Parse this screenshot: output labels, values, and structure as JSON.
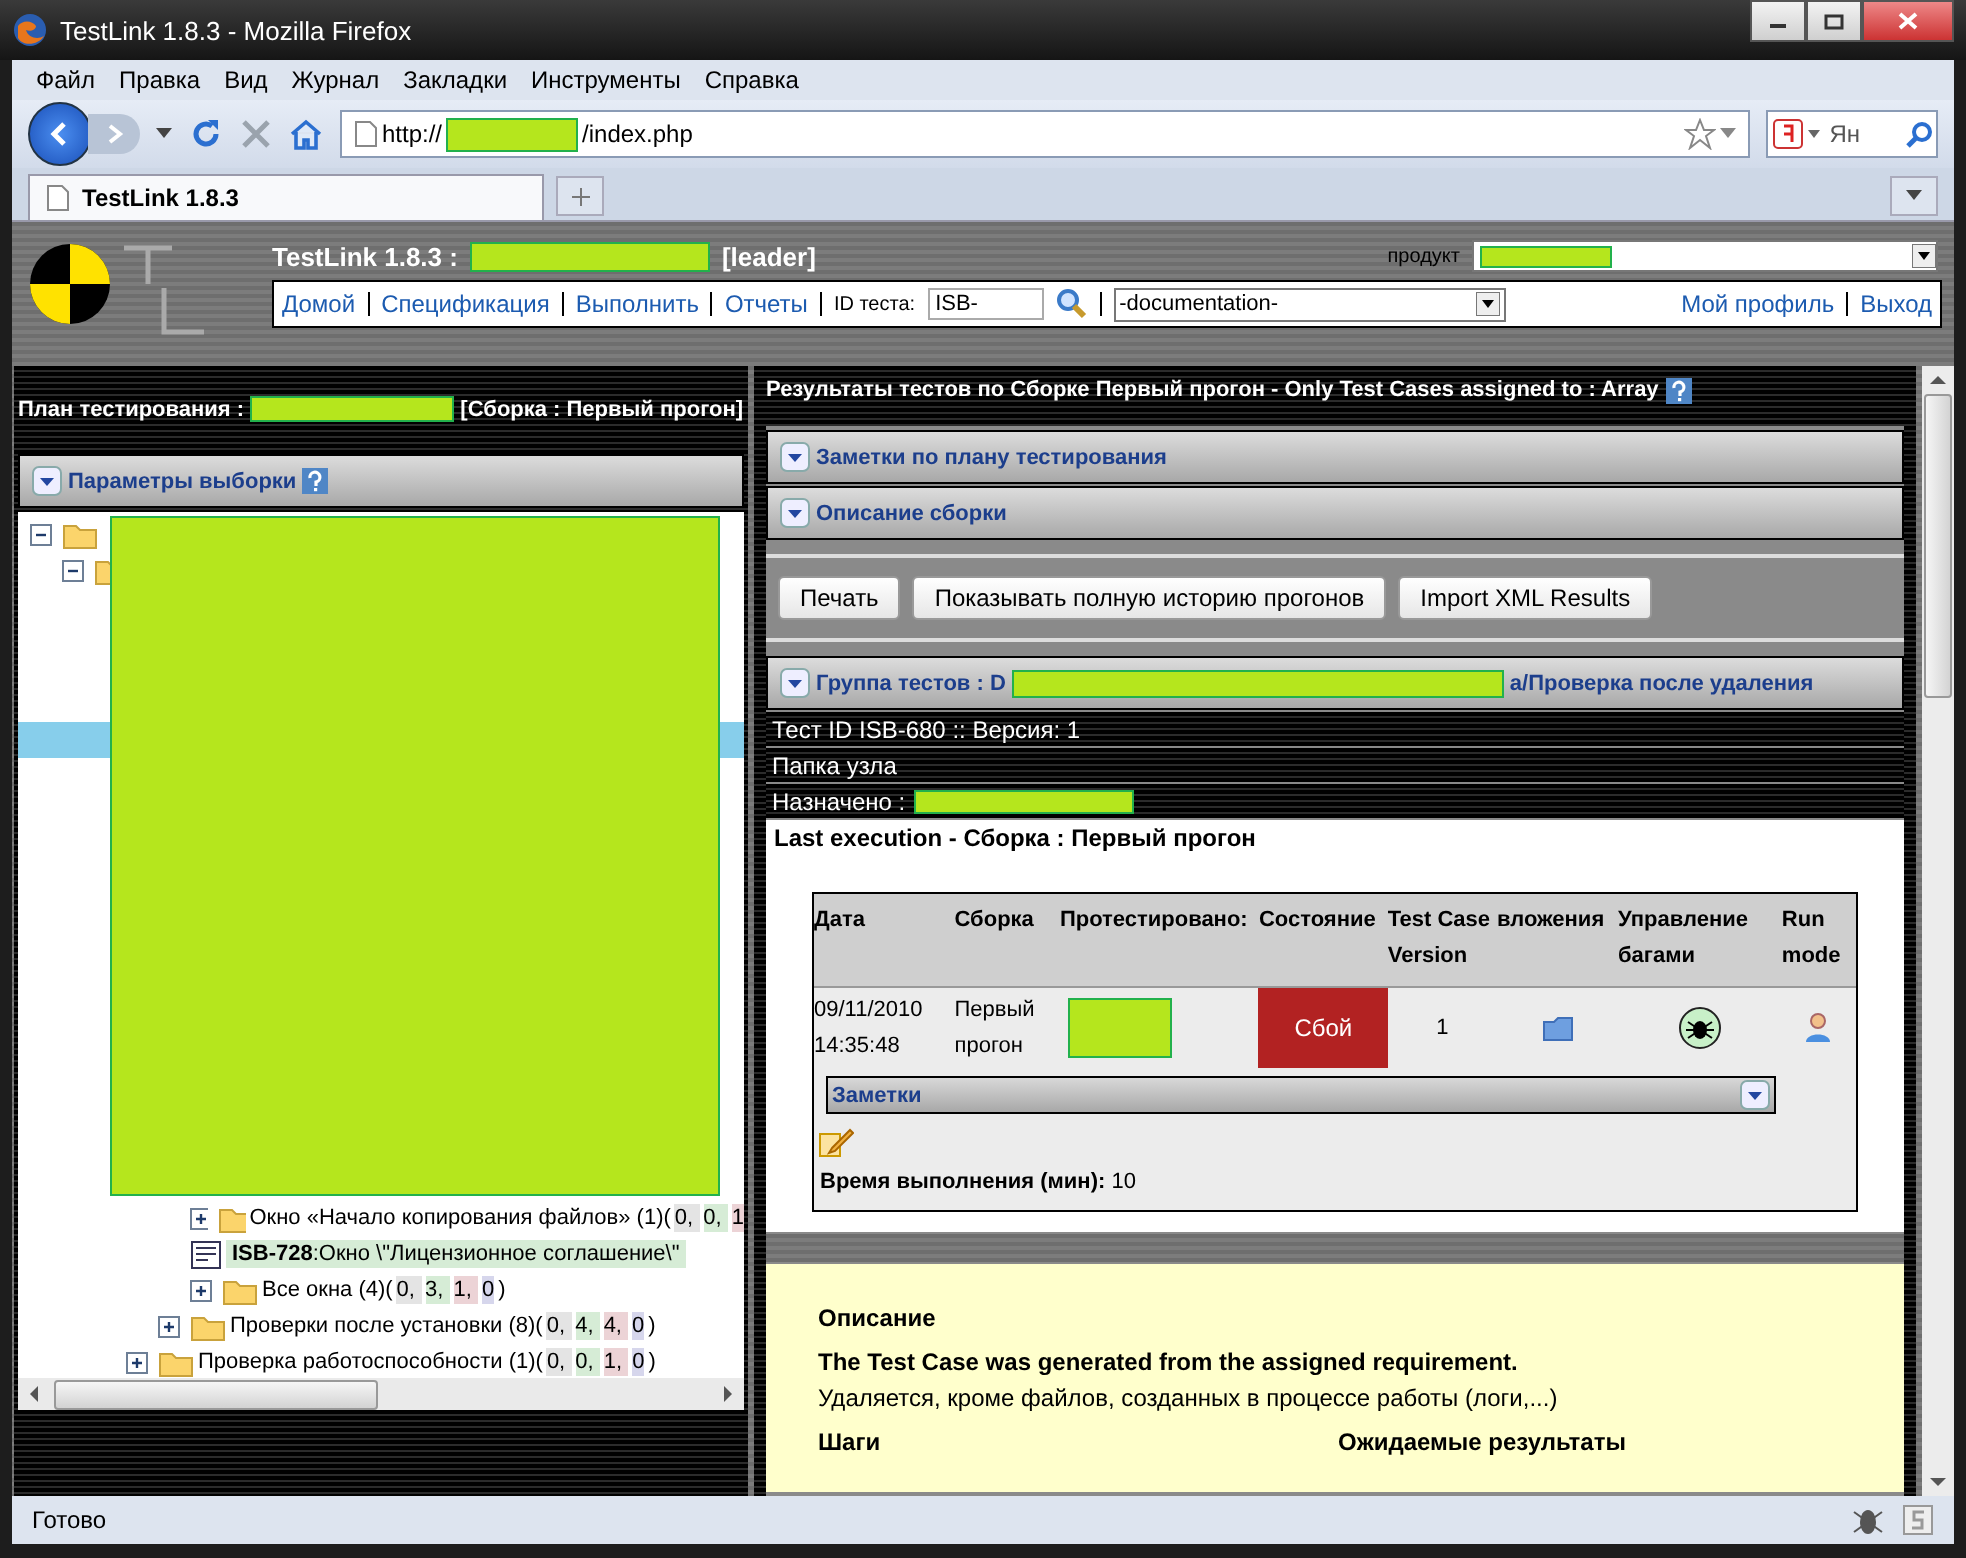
{
  "window": {
    "title": "TestLink 1.8.3 - Mozilla Firefox"
  },
  "menu": [
    "Файл",
    "Правка",
    "Вид",
    "Журнал",
    "Закладки",
    "Инструменты",
    "Справка"
  ],
  "address": {
    "prefix": "http://",
    "suffix": "/index.php"
  },
  "search": {
    "placeholder": "Ян"
  },
  "tabs": [
    {
      "label": "TestLink 1.8.3",
      "selected": true
    }
  ],
  "header": {
    "title": "TestLink 1.8.3 :",
    "role": "[leader]",
    "product_label": "продукт",
    "nav": [
      "Домой",
      "Спецификация",
      "Выполнить",
      "Отчеты"
    ],
    "test_id_label": "ID теста:",
    "test_id_value": "ISB-",
    "doc_select": "-documentation-",
    "user_links": [
      "Мой профиль",
      "Выход"
    ]
  },
  "left": {
    "plan_label": "План тестирования :",
    "build_text": "[Сборка : Первый прогон]",
    "filter_title": "Параметры выборки",
    "tree": [
      {
        "expanded": true,
        "children": [
          {
            "expanded": true,
            "children": [
              {
                "children": [
                  {
                    "children": [
                      {
                        "children": [
                          {
                            "label": "Окно «Начало копирования файлов» (1)(",
                            "counts": [
                              "0, ",
                              "0, ",
                              "1"
                            ],
                            "expanded": false
                          },
                          {
                            "kind": "testcase",
                            "id": "ISB-728",
                            "label": ":Окно \\\"Лицензионное соглашение\\\""
                          },
                          {
                            "label": "Все окна (4)(",
                            "counts": [
                              "0, ",
                              "3, ",
                              "1, ",
                              "0"
                            ],
                            "close": ")",
                            "expanded": false
                          }
                        ]
                      },
                      {
                        "label": "Проверки после установки (8)(",
                        "counts": [
                          "0, ",
                          "4, ",
                          "4, ",
                          "0"
                        ],
                        "close": ")",
                        "expanded": false
                      }
                    ]
                  },
                  {
                    "label": "Проверка работоспособности (1)(",
                    "counts": [
                      "0, ",
                      "0, ",
                      "1, ",
                      "0"
                    ],
                    "close": ")",
                    "expanded": false
                  }
                ]
              }
            ]
          }
        ]
      }
    ]
  },
  "right": {
    "title": "Результаты тестов по Сборке Первый прогон - Only Test Cases assigned to : Array",
    "panels": [
      "Заметки по плану тестирования",
      "Описание сборки"
    ],
    "buttons": [
      "Печать",
      "Показывать полную историю прогонов",
      "Import XML Results"
    ],
    "suite": {
      "prefix": "Группа тестов : D",
      "suffix": "а/Проверка после удаления"
    },
    "info": [
      "Тест ID ISB-680 :: Версия: 1",
      "Папка узла"
    ],
    "assigned_label": "Назначено :",
    "last_execution": "Last execution - Сборка : Первый прогон",
    "table": {
      "columns": [
        "Дата",
        "Сборка",
        "Протестировано:",
        "Состояние",
        "Test Case Version",
        "вложения",
        "Управление багами",
        "Run mode"
      ],
      "row": {
        "date": "09/11/2010 14:35:48",
        "build": "Первый прогон",
        "status": "Сбой",
        "color": "#b22222",
        "version": "1"
      },
      "notes": "Заметки",
      "duration_label": "Время выполнения (мин):",
      "duration": "10"
    },
    "description": {
      "heading": "Описание",
      "bold_line": "The Test Case was generated from the assigned requirement.",
      "text": "Удаляется, кроме файлов, созданных в процессе работы (логи,...)",
      "steps": "Шаги",
      "expected": "Ожидаемые результаты"
    }
  },
  "status_bar": "Готово"
}
